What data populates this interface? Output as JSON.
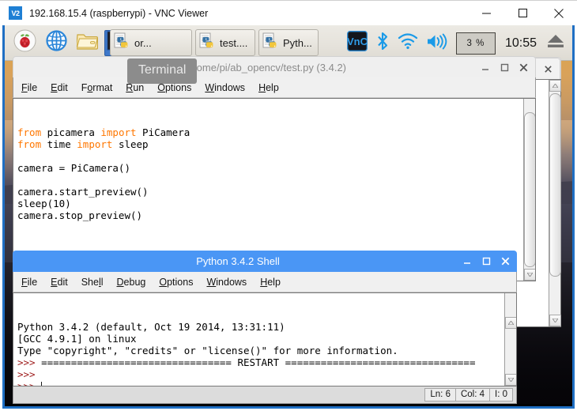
{
  "vnc": {
    "app_icon_label": "V2",
    "title": "192.168.15.4 (raspberrypi) - VNC Viewer",
    "controls": {
      "minimize": "minimize-icon",
      "maximize": "maximize-icon",
      "close": "close-icon"
    },
    "border_color": "#1f6fc4"
  },
  "taskbar": {
    "launchers": [
      {
        "name": "raspberry-menu",
        "icon": "raspberry-icon"
      },
      {
        "name": "web-browser",
        "icon": "globe-icon"
      },
      {
        "name": "file-manager",
        "icon": "folder-icon"
      },
      {
        "name": "terminal",
        "icon": "terminal-icon"
      }
    ],
    "windows": [
      {
        "label": "or...",
        "icon": "python-file-icon"
      },
      {
        "label": "test....",
        "icon": "python-file-icon"
      },
      {
        "label": "Pyth...",
        "icon": "python-file-icon"
      }
    ],
    "tooltip": "Terminal",
    "tray": {
      "vnc_icon": "vnc-icon",
      "bluetooth_icon": "bluetooth-icon",
      "wifi_icon": "wifi-icon",
      "volume_icon": "volume-icon",
      "cpu_percent": "3 %",
      "clock": "10:55",
      "eject_icon": "eject-icon"
    },
    "accent_blue": "#3e78c9"
  },
  "editor_window": {
    "title": "test.py - /home/pi/ab_opencv/test.py (3.4.2)",
    "active": false,
    "menus": [
      {
        "label": "File",
        "mnemonic": "F"
      },
      {
        "label": "Edit",
        "mnemonic": "E"
      },
      {
        "label": "Format",
        "mnemonic": "o"
      },
      {
        "label": "Run",
        "mnemonic": "R"
      },
      {
        "label": "Options",
        "mnemonic": "O"
      },
      {
        "label": "Windows",
        "mnemonic": "W"
      },
      {
        "label": "Help",
        "mnemonic": "H"
      }
    ],
    "code_lines": [
      [
        {
          "t": "from",
          "c": "kw"
        },
        {
          "t": " picamera ",
          "c": ""
        },
        {
          "t": "import",
          "c": "kw"
        },
        {
          "t": " PiCamera",
          "c": ""
        }
      ],
      [
        {
          "t": "from",
          "c": "kw"
        },
        {
          "t": " time ",
          "c": ""
        },
        {
          "t": "import",
          "c": "kw"
        },
        {
          "t": " sleep",
          "c": ""
        }
      ],
      [
        {
          "t": "",
          "c": ""
        }
      ],
      [
        {
          "t": "camera = PiCamera()",
          "c": ""
        }
      ],
      [
        {
          "t": "",
          "c": ""
        }
      ],
      [
        {
          "t": "camera.start_preview()",
          "c": ""
        }
      ],
      [
        {
          "t": "sleep(10)",
          "c": ""
        }
      ],
      [
        {
          "t": "camera.stop_preview()",
          "c": ""
        }
      ]
    ]
  },
  "shell_window": {
    "title": "Python 3.4.2 Shell",
    "active": true,
    "title_color": "#4a96f5",
    "menus": [
      {
        "label": "File",
        "mnemonic": "F"
      },
      {
        "label": "Edit",
        "mnemonic": "E"
      },
      {
        "label": "Shell",
        "mnemonic": "l"
      },
      {
        "label": "Debug",
        "mnemonic": "D"
      },
      {
        "label": "Options",
        "mnemonic": "O"
      },
      {
        "label": "Windows",
        "mnemonic": "W"
      },
      {
        "label": "Help",
        "mnemonic": "H"
      }
    ],
    "output_lines": [
      [
        {
          "t": "Python 3.4.2 (default, Oct 19 2014, 13:31:11)",
          "c": ""
        }
      ],
      [
        {
          "t": "[GCC 4.9.1] on linux",
          "c": ""
        }
      ],
      [
        {
          "t": "Type \"copyright\", \"credits\" or \"license()\" for more information.",
          "c": ""
        }
      ],
      [
        {
          "t": ">>>",
          "c": "prompt"
        },
        {
          "t": " ================================ RESTART ================================",
          "c": ""
        }
      ],
      [
        {
          "t": ">>>",
          "c": "prompt"
        }
      ],
      [
        {
          "t": ">>>",
          "c": "prompt"
        },
        {
          "t": " ",
          "c": ""
        },
        {
          "t": "|",
          "c": "caret"
        }
      ]
    ],
    "status": {
      "line": "Ln: 6",
      "col": "Col: 4",
      "indent": "I: 0"
    }
  }
}
